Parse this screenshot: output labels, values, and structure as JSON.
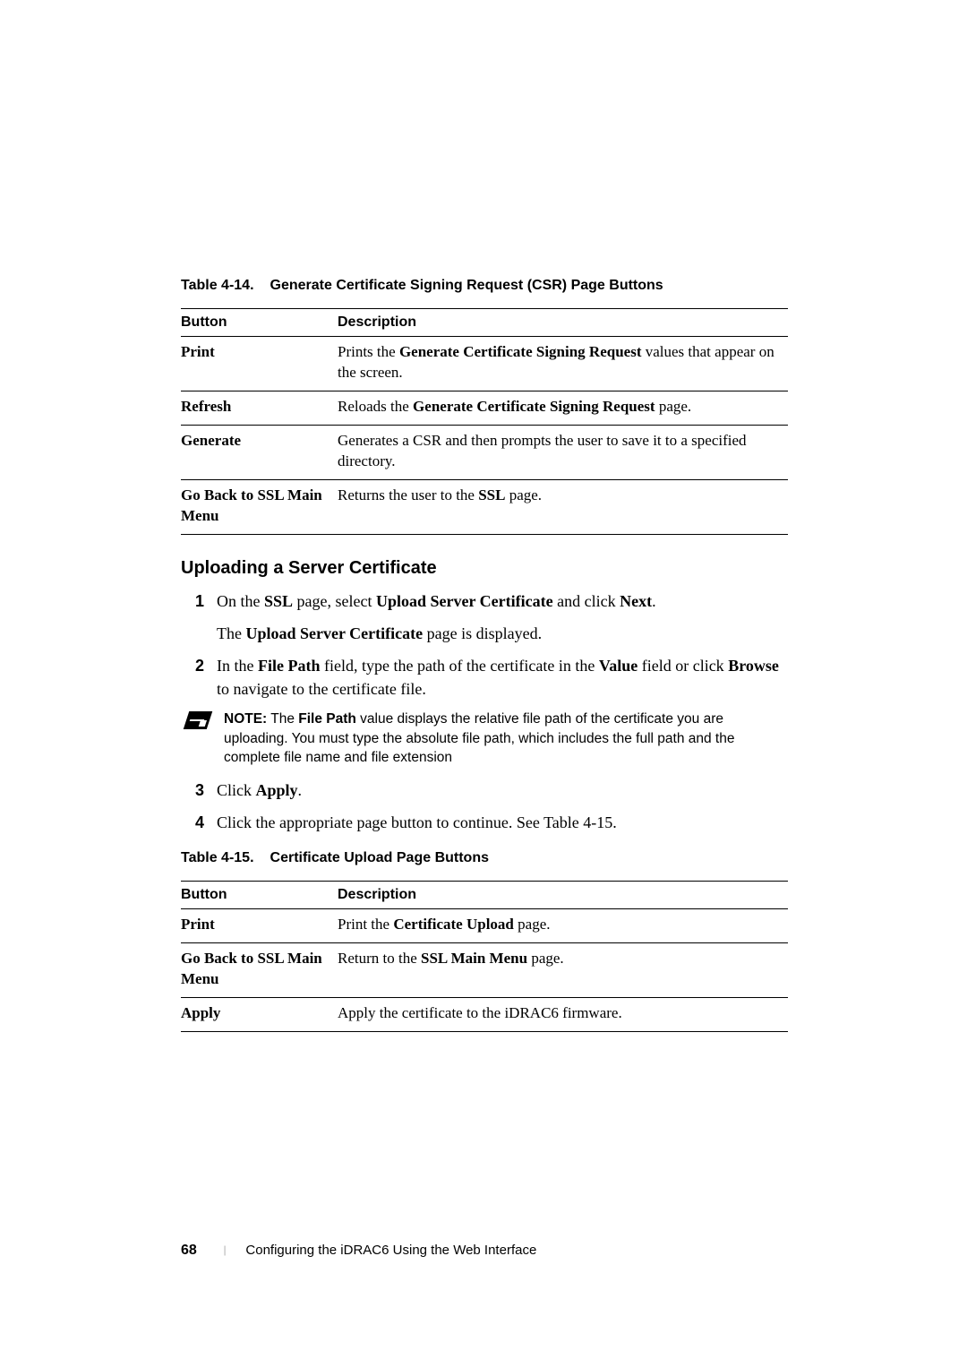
{
  "table414": {
    "caption_num": "Table 4-14.",
    "caption_title": "Generate Certificate Signing Request (CSR) Page Buttons",
    "col1": "Button",
    "col2": "Description",
    "rows": {
      "r0c0": "Print",
      "r0c1_a": "Prints the ",
      "r0c1_b": "Generate Certificate Signing Request",
      "r0c1_c": " values that appear on the screen.",
      "r1c0": "Refresh",
      "r1c1_a": "Reloads the ",
      "r1c1_b": "Generate Certificate Signing Request",
      "r1c1_c": " page.",
      "r2c0": "Generate",
      "r2c1": "Generates a CSR and then prompts the user to save it to a specified directory.",
      "r3c0": "Go Back to SSL Main Menu",
      "r3c1_a": "Returns the user to the ",
      "r3c1_b": "SSL",
      "r3c1_c": " page."
    }
  },
  "section_heading": "Uploading a Server Certificate",
  "steps": {
    "s1n": "1",
    "s1a": "On the ",
    "s1b": "SSL",
    "s1c": " page, select ",
    "s1d": "Upload Server Certificate",
    "s1e": " and click ",
    "s1f": "Next",
    "s1g": ".",
    "s1sub_a": "The ",
    "s1sub_b": "Upload Server Certificate",
    "s1sub_c": " page is displayed.",
    "s2n": "2",
    "s2a": "In the ",
    "s2b": "File Path",
    "s2c": " field, type the path of the certificate in the ",
    "s2d": "Value",
    "s2e": " field or click ",
    "s2f": "Browse",
    "s2g": " to navigate to the certificate file.",
    "s3n": "3",
    "s3a": "Click ",
    "s3b": "Apply",
    "s3c": ".",
    "s4n": "4",
    "s4": "Click the appropriate page button to continue. See Table 4-15."
  },
  "note": {
    "label": "NOTE:",
    "t1": " The ",
    "t2": "File Path",
    "t3": " value displays the relative file path of the certificate you are uploading. You must type the absolute file path, which includes the full path and the complete file name and file extension"
  },
  "table415": {
    "caption_num": "Table 4-15.",
    "caption_title": "Certificate Upload Page Buttons",
    "col1": "Button",
    "col2": "Description",
    "rows": {
      "r0c0": "Print",
      "r0c1_a": "Print the ",
      "r0c1_b": "Certificate Upload",
      "r0c1_c": " page.",
      "r1c0": "Go Back to SSL Main Menu",
      "r1c1_a": "Return to the ",
      "r1c1_b": "SSL Main Menu",
      "r1c1_c": " page.",
      "r2c0": "Apply",
      "r2c1": "Apply the certificate to the iDRAC6 firmware."
    }
  },
  "footer": {
    "page_no": "68",
    "sep": "|",
    "chapter": "Configuring the iDRAC6 Using the Web Interface"
  }
}
